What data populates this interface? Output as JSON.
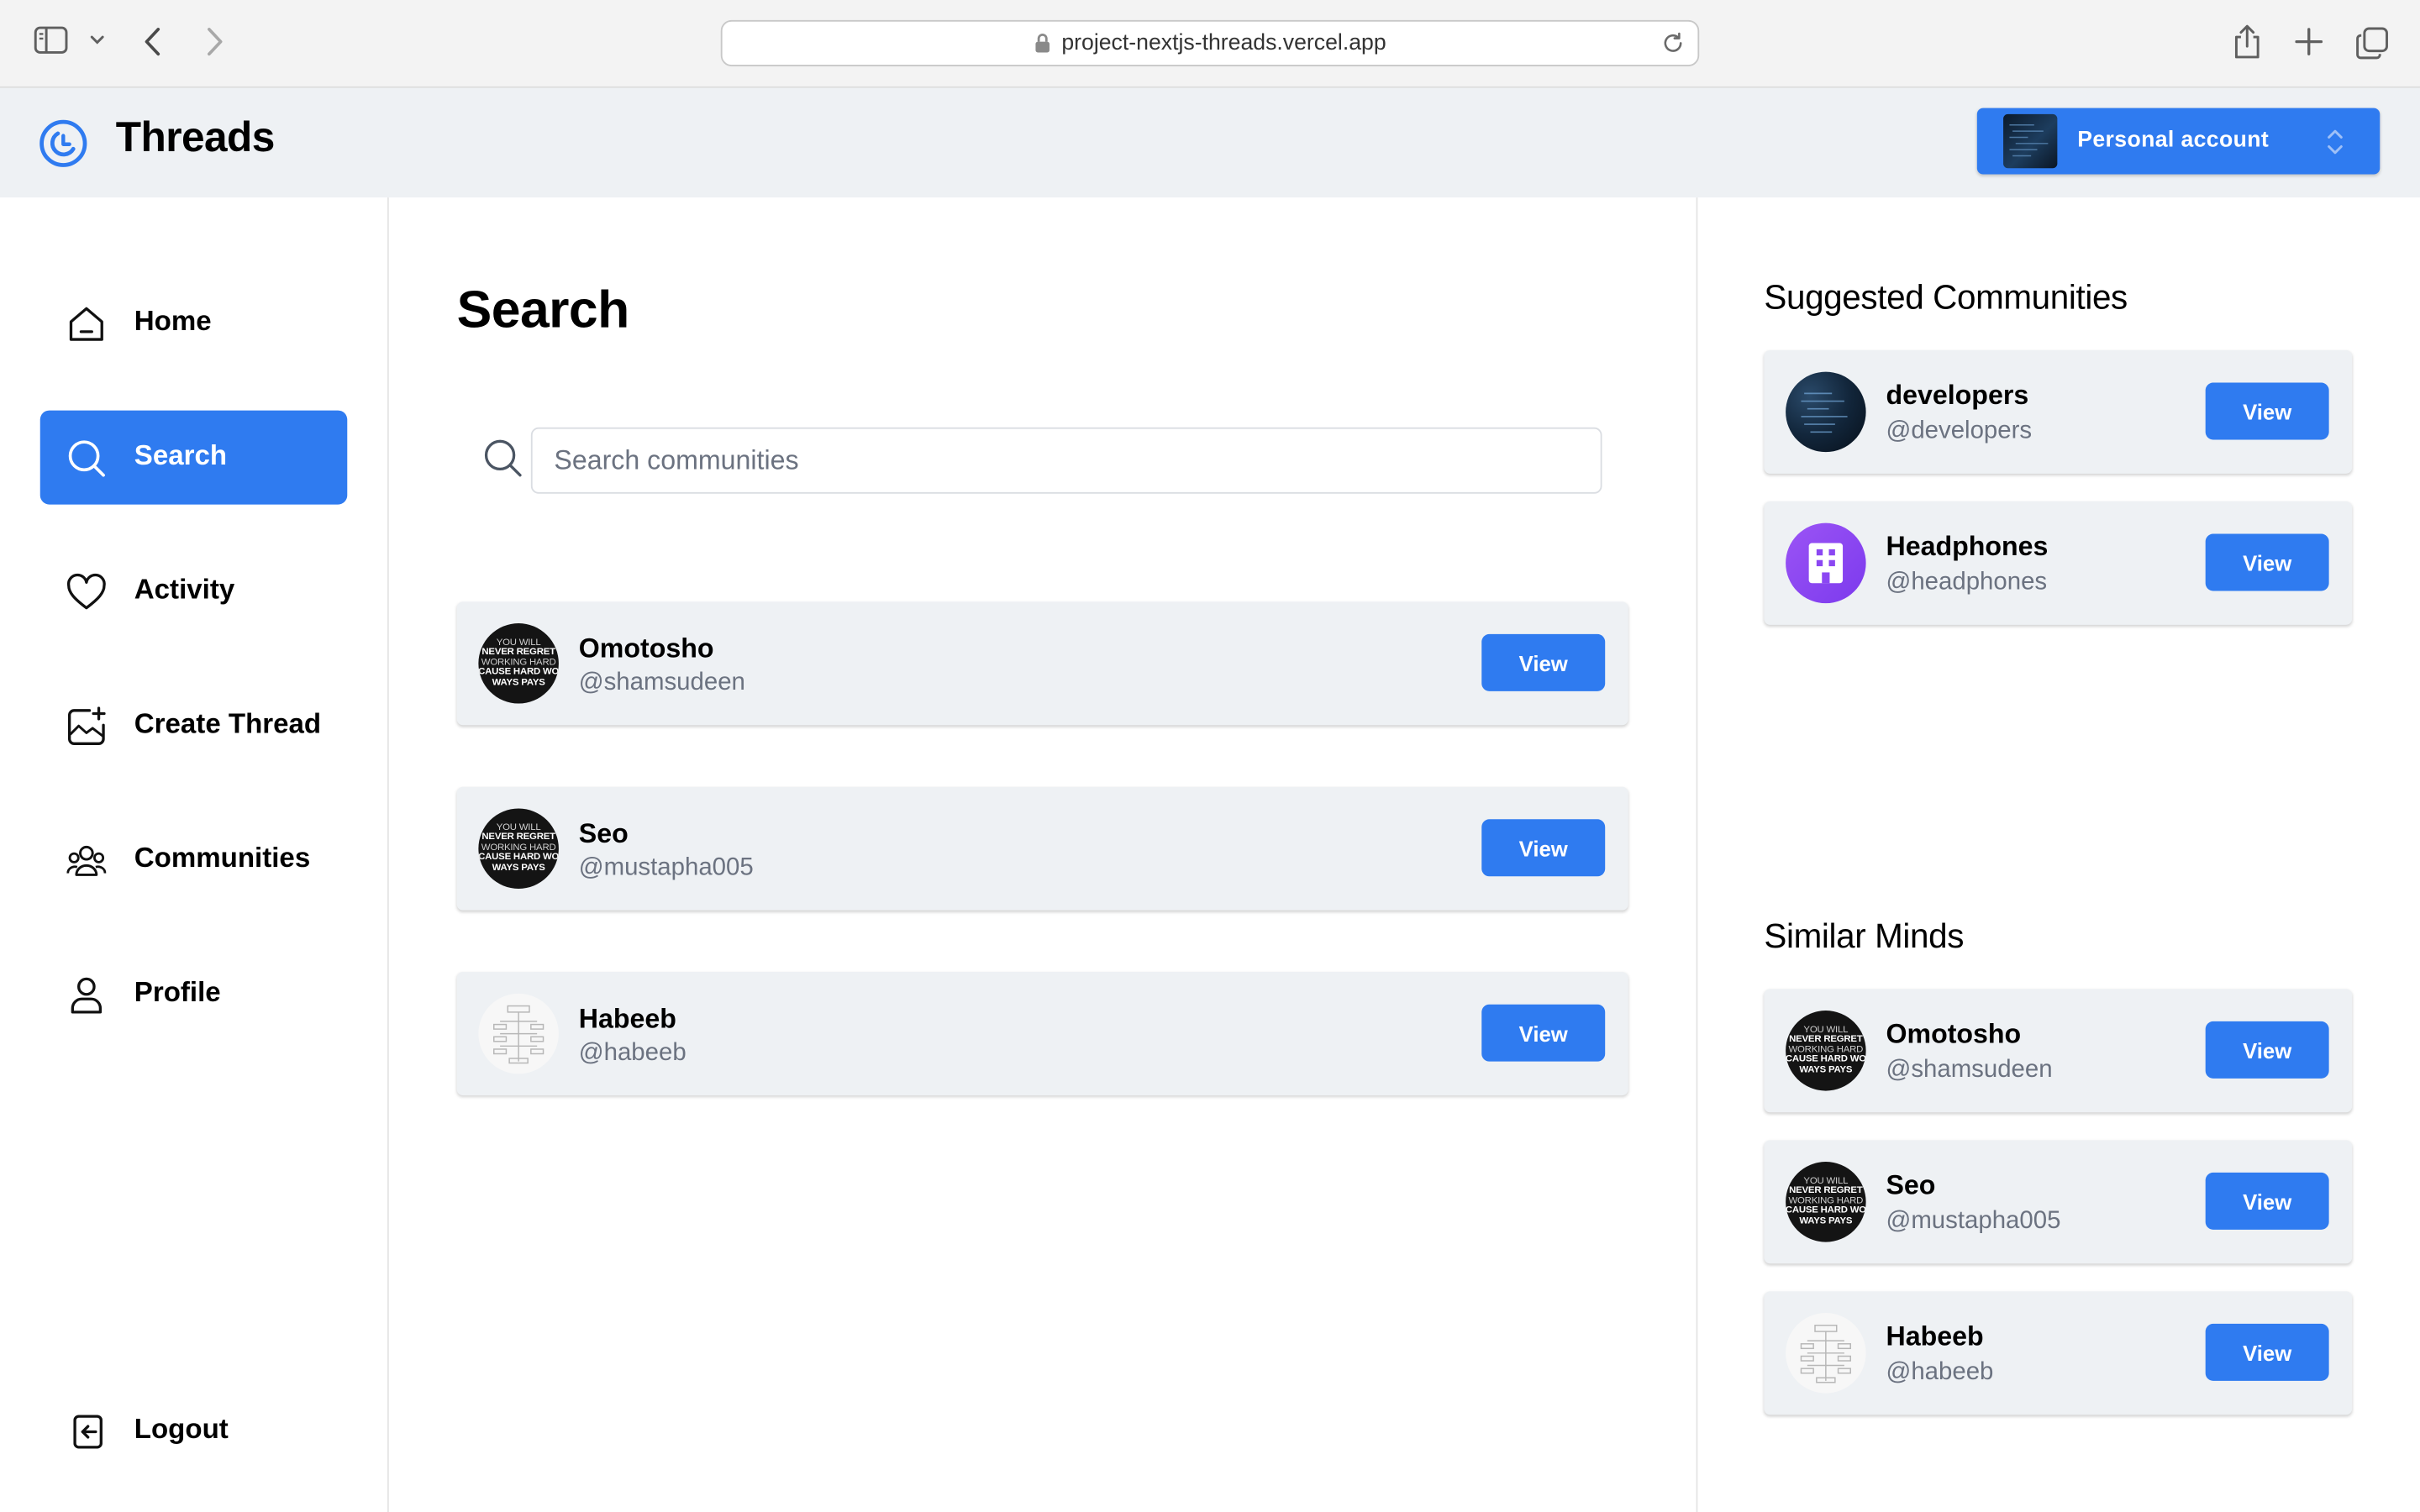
{
  "browser": {
    "url": "project-nextjs-threads.vercel.app"
  },
  "header": {
    "brand": "Threads",
    "account_label": "Personal account"
  },
  "sidebar": {
    "items": [
      {
        "label": "Home",
        "icon": "home-icon"
      },
      {
        "label": "Search",
        "icon": "search-icon",
        "active": true
      },
      {
        "label": "Activity",
        "icon": "heart-icon"
      },
      {
        "label": "Create Thread",
        "icon": "create-thread-icon"
      },
      {
        "label": "Communities",
        "icon": "communities-icon"
      },
      {
        "label": "Profile",
        "icon": "user-icon"
      }
    ],
    "logout": "Logout"
  },
  "main": {
    "title": "Search",
    "search": {
      "placeholder": "Search communities",
      "value": ""
    },
    "results": [
      {
        "name": "Omotosho",
        "handle": "@shamsudeen",
        "avatar": "motivational-quote",
        "button": "View"
      },
      {
        "name": "Seo",
        "handle": "@mustapha005",
        "avatar": "motivational-quote",
        "button": "View"
      },
      {
        "name": "Habeeb",
        "handle": "@habeeb",
        "avatar": "diagram",
        "button": "View"
      }
    ]
  },
  "right": {
    "suggested_title": "Suggested Communities",
    "communities": [
      {
        "name": "developers",
        "handle": "@developers",
        "avatar": "code-screen",
        "button": "View"
      },
      {
        "name": "Headphones",
        "handle": "@headphones",
        "avatar": "building",
        "button": "View"
      }
    ],
    "similar_title": "Similar Minds",
    "similar": [
      {
        "name": "Omotosho",
        "handle": "@shamsudeen",
        "avatar": "motivational-quote",
        "button": "View"
      },
      {
        "name": "Seo",
        "handle": "@mustapha005",
        "avatar": "motivational-quote",
        "button": "View"
      },
      {
        "name": "Habeeb",
        "handle": "@habeeb",
        "avatar": "diagram",
        "button": "View"
      }
    ]
  },
  "avatar_text": {
    "motivational": [
      "YOU WILL",
      "NEVER REGRET",
      "WORKING HARD",
      "CAUSE HARD WO",
      "WAYS PAYS"
    ]
  },
  "colors": {
    "accent": "#2f7bf0",
    "panel": "#eef1f4",
    "muted": "#6b7280"
  }
}
